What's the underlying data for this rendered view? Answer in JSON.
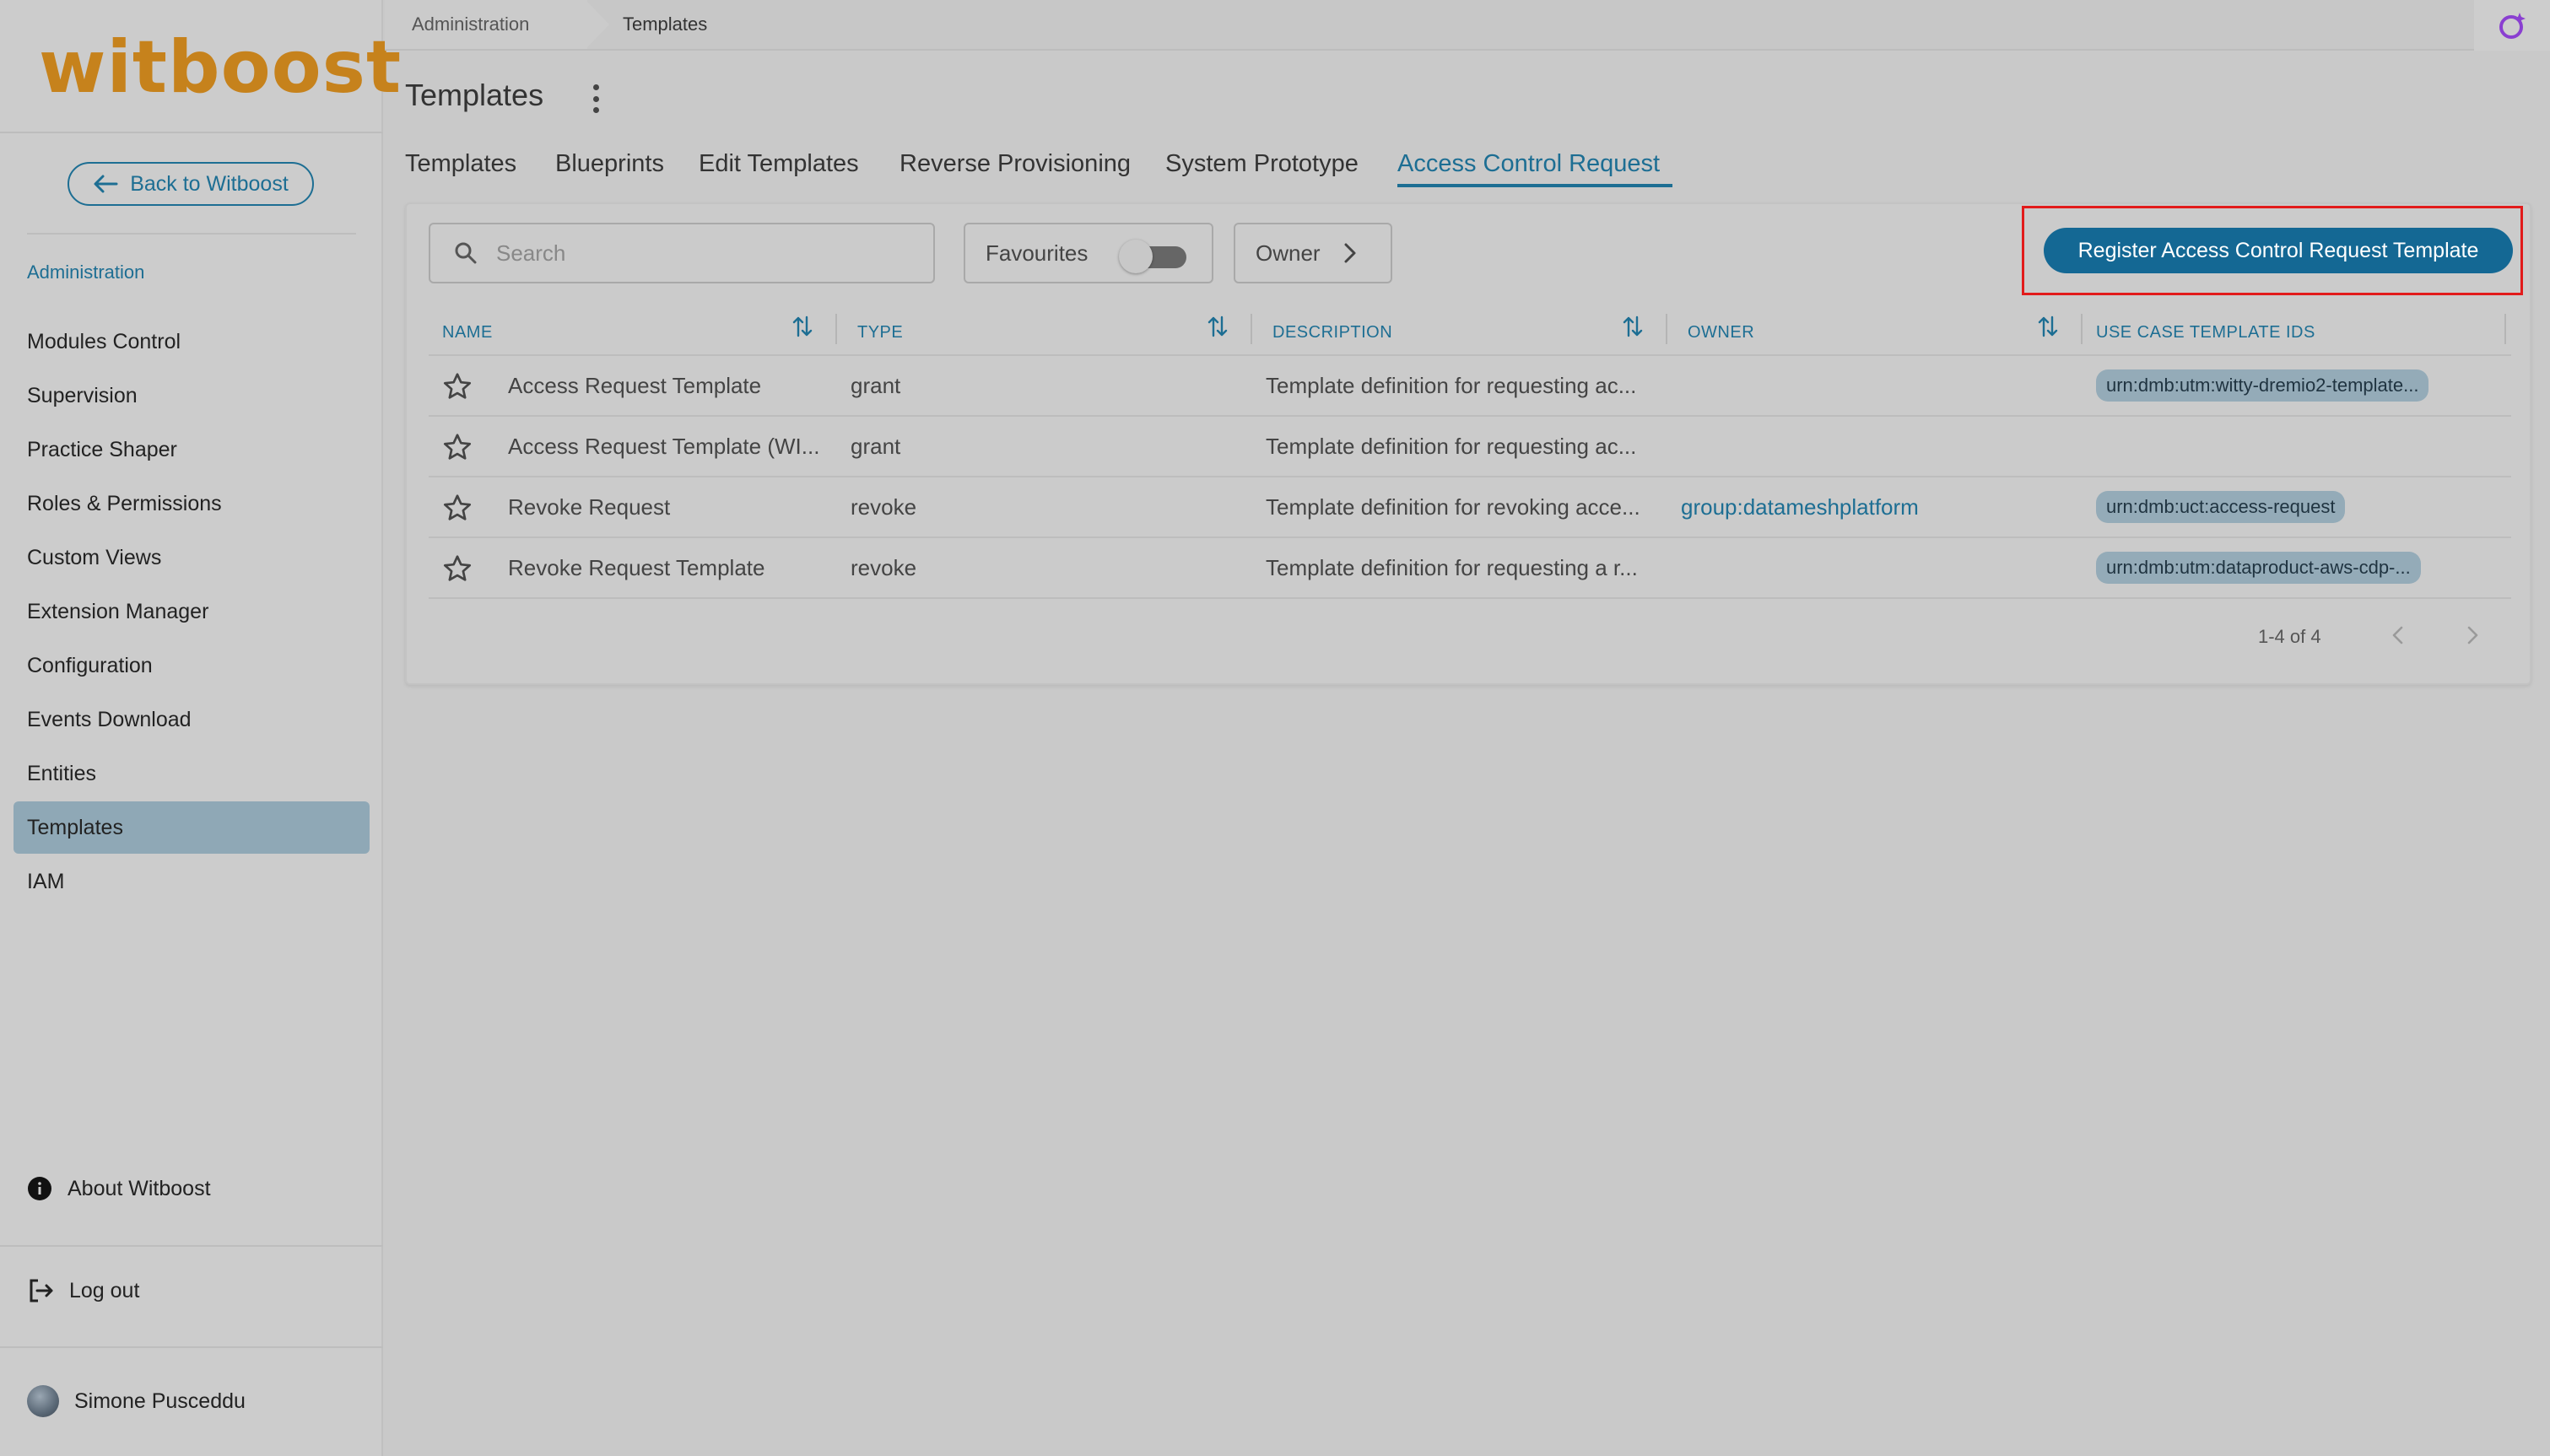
{
  "brand": {
    "logo_text": "witboost"
  },
  "sidebar": {
    "back_label": "Back to Witboost",
    "section_label": "Administration",
    "items": [
      {
        "label": "Modules Control"
      },
      {
        "label": "Supervision"
      },
      {
        "label": "Practice Shaper"
      },
      {
        "label": "Roles & Permissions"
      },
      {
        "label": "Custom Views"
      },
      {
        "label": "Extension Manager"
      },
      {
        "label": "Configuration"
      },
      {
        "label": "Events Download"
      },
      {
        "label": "Entities"
      },
      {
        "label": "Templates",
        "active": true
      },
      {
        "label": "IAM"
      }
    ],
    "about_label": "About Witboost",
    "logout_label": "Log out",
    "user_name": "Simone Pusceddu"
  },
  "breadcrumb": {
    "parent": "Administration",
    "current": "Templates"
  },
  "page": {
    "title": "Templates"
  },
  "tabs": [
    {
      "label": "Templates"
    },
    {
      "label": "Blueprints"
    },
    {
      "label": "Edit Templates"
    },
    {
      "label": "Reverse Provisioning"
    },
    {
      "label": "System Prototype"
    },
    {
      "label": "Access Control Request",
      "active": true
    }
  ],
  "toolbar": {
    "search_placeholder": "Search",
    "favourites_label": "Favourites",
    "favourites_on": false,
    "owner_label": "Owner",
    "register_label": "Register Access Control Request Template"
  },
  "table": {
    "columns": [
      "NAME",
      "TYPE",
      "DESCRIPTION",
      "OWNER",
      "USE CASE TEMPLATE IDS"
    ],
    "rows": [
      {
        "name": "Access Request Template",
        "type": "grant",
        "description": "Template definition for requesting ac...",
        "owner": "",
        "use_case_ids": "urn:dmb:utm:witty-dremio2-template..."
      },
      {
        "name": "Access Request Template (WI...",
        "type": "grant",
        "description": "Template definition for requesting ac...",
        "owner": "",
        "use_case_ids": ""
      },
      {
        "name": "Revoke Request",
        "type": "revoke",
        "description": "Template definition for revoking acce...",
        "owner": "group:datameshplatform",
        "use_case_ids": "urn:dmb:uct:access-request"
      },
      {
        "name": "Revoke Request Template",
        "type": "revoke",
        "description": "Template definition for requesting a r...",
        "owner": "",
        "use_case_ids": "urn:dmb:utm:dataproduct-aws-cdp-..."
      }
    ]
  },
  "pagination": {
    "range": "1-4 of 4"
  },
  "colors": {
    "accent": "#1d6e93",
    "brand": "#c6821c",
    "primary_button": "#146894",
    "highlight": "#e21b1b",
    "active_nav": "#8fa8b6"
  }
}
